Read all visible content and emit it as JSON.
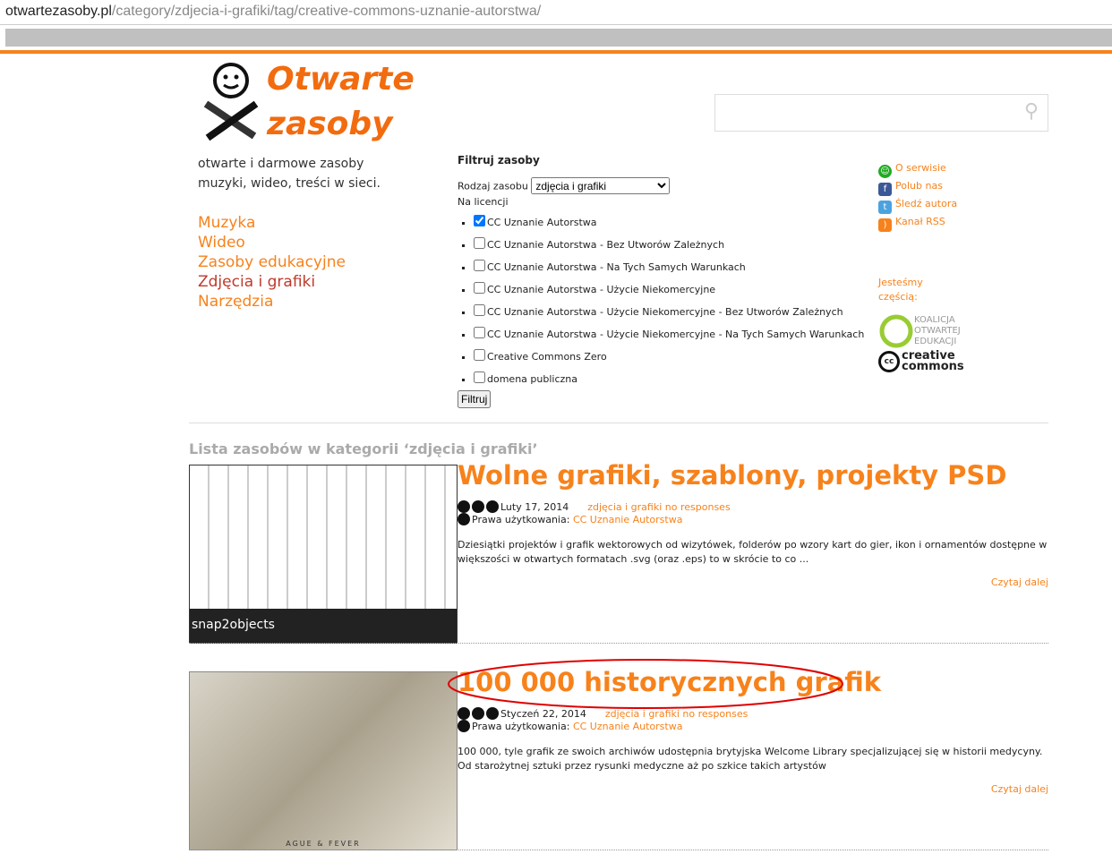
{
  "browser": {
    "url_domain": "otwartezasoby.pl",
    "url_path": "/category/zdjecia-i-grafiki/tag/creative-commons-uznanie-autorstwa/"
  },
  "logo": {
    "line1": "Otwarte",
    "line2": "zasoby"
  },
  "search": {
    "placeholder": "",
    "icon": "search-icon"
  },
  "tagline": "otwarte i darmowe zasoby muzyki, wideo, treści w sieci.",
  "nav": [
    {
      "label": "Muzyka"
    },
    {
      "label": "Wideo"
    },
    {
      "label": "Zasoby edukacyjne"
    },
    {
      "label": "Zdjęcia i grafiki",
      "active": true
    },
    {
      "label": "Narzędzia"
    }
  ],
  "filter": {
    "title": "Filtruj zasoby",
    "type_label": "Rodzaj zasobu",
    "type_value": "zdjęcia i grafiki",
    "license_label": "Na licencji",
    "licenses": [
      {
        "label": "CC Uznanie Autorstwa",
        "checked": true
      },
      {
        "label": "CC Uznanie Autorstwa - Bez Utworów Zależnych"
      },
      {
        "label": "CC Uznanie Autorstwa - Na Tych Samych Warunkach"
      },
      {
        "label": "CC Uznanie Autorstwa - Użycie Niekomercyjne"
      },
      {
        "label": "CC Uznanie Autorstwa - Użycie Niekomercyjne - Bez Utworów Zależnych"
      },
      {
        "label": "CC Uznanie Autorstwa - Użycie Niekomercyjne - Na Tych Samych Warunkach"
      },
      {
        "label": "Creative Commons Zero"
      },
      {
        "label": "domena publiczna"
      }
    ],
    "button": "Filtruj"
  },
  "side": {
    "links": [
      "O serwisie",
      "Polub nas",
      "Śledź autora",
      "Kanał RSS"
    ],
    "part_of": "Jesteśmy częścią:",
    "koalicja": "KOALICJA OTWARTEJ EDUKACJI",
    "cc": "creative commons"
  },
  "list_title": "Lista zasobów w kategorii ‘zdjęcia i grafiki’",
  "posts": [
    {
      "title": "Wolne grafiki, szablony, projekty PSD",
      "date": "Luty 17, 2014",
      "category": "zdjęcia i grafiki",
      "comments": "no responses",
      "rights_label": "Prawa użytkowania:",
      "rights": "CC Uznanie Autorstwa",
      "excerpt": "Dziesiątki projektów i grafik wektorowych od wizytówek, folderów po wzory kart do gier, ikon i ornamentów dostępne w większości w otwartych formatach .svg (oraz .eps) to w skrócie to co ...",
      "more": "Czytaj dalej",
      "thumb_caption": "snap2objects"
    },
    {
      "title": "100 000 historycznych grafik",
      "date": "Styczeń 22, 2014",
      "category": "zdjęcia i grafiki",
      "comments": "no responses",
      "rights_label": "Prawa użytkowania:",
      "rights": "CC Uznanie Autorstwa",
      "excerpt": "100 000, tyle grafik ze swoich archiwów udostępnia brytyjska Welcome Library specjalizującej się w historii medycyny. Od starożytnej sztuki przez rysunki medyczne aż po szkice takich artystów",
      "more": "Czytaj dalej",
      "thumb_caption": "AGUE & FEVER"
    }
  ],
  "colors": {
    "accent": "#f7821b",
    "highlight_ellipse": "#e00000"
  }
}
